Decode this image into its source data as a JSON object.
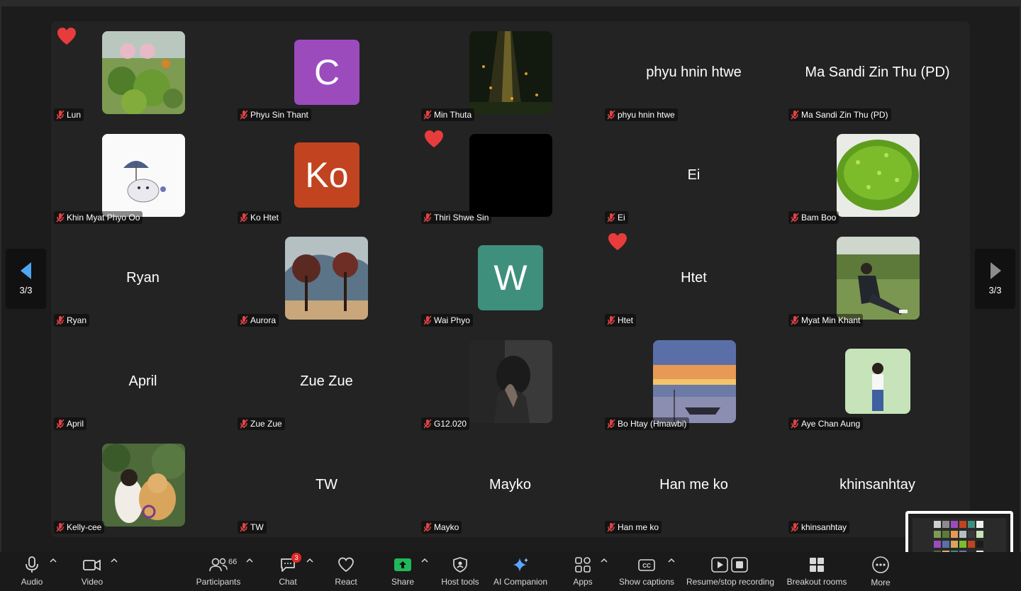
{
  "pager": {
    "left_label": "3/3",
    "right_label": "3/3"
  },
  "participants": [
    {
      "name": "Lun",
      "tile": "photo",
      "photo": "plants"
    },
    {
      "name": "Phyu Sin Thant",
      "tile": "avatar",
      "initials": "C",
      "color": "#9c4bbd"
    },
    {
      "name": "Min Thuta",
      "tile": "photo",
      "photo": "forest-rays"
    },
    {
      "name": "phyu hnin htwe",
      "tile": "name",
      "display": "phyu hnin htwe"
    },
    {
      "name": "Ma Sandi Zin Thu (PD)",
      "tile": "name",
      "display": "Ma Sandi Zin Thu (PD)"
    },
    {
      "name": "Khin Myat Phyo Oo",
      "tile": "photo",
      "photo": "sketch"
    },
    {
      "name": "Ko Htet",
      "tile": "avatar",
      "initials": "Ko",
      "color": "#c2431f"
    },
    {
      "name": "Thiri Shwe Sin",
      "tile": "photo",
      "photo": "black"
    },
    {
      "name": "Ei",
      "tile": "name",
      "display": "Ei"
    },
    {
      "name": "Bam Boo",
      "tile": "photo",
      "photo": "green-beads"
    },
    {
      "name": "Ryan",
      "tile": "name",
      "display": "Ryan"
    },
    {
      "name": "Aurora",
      "tile": "photo",
      "photo": "trees"
    },
    {
      "name": "Wai Phyo",
      "tile": "avatar",
      "initials": "W",
      "color": "#3f8f7d"
    },
    {
      "name": "Htet",
      "tile": "name",
      "display": "Htet"
    },
    {
      "name": "Myat Min Khant",
      "tile": "photo",
      "photo": "field"
    },
    {
      "name": "April",
      "tile": "name",
      "display": "April"
    },
    {
      "name": "Zue Zue",
      "tile": "name",
      "display": "Zue Zue"
    },
    {
      "name": "G12.020",
      "tile": "photo",
      "photo": "portrait-dark"
    },
    {
      "name": "Bo Htay (Hmawbi)",
      "tile": "photo",
      "photo": "sunset"
    },
    {
      "name": "Aye Chan Aung",
      "tile": "photo",
      "photo": "standing-person"
    },
    {
      "name": "Kelly-cee",
      "tile": "photo",
      "photo": "girl-dog"
    },
    {
      "name": "TW",
      "tile": "name",
      "display": "TW"
    },
    {
      "name": "Mayko",
      "tile": "name",
      "display": "Mayko"
    },
    {
      "name": "Han me ko",
      "tile": "name",
      "display": "Han me ko"
    },
    {
      "name": "khinsanhtay",
      "tile": "name",
      "display": "khinsanhtay"
    }
  ],
  "reactions": [
    {
      "participant": "Lun",
      "emoji": "heart"
    },
    {
      "participant": "Thiri Shwe Sin",
      "emoji": "heart"
    },
    {
      "participant": "Htet",
      "emoji": "heart"
    }
  ],
  "toolbar": {
    "audio": "Audio",
    "video": "Video",
    "participants": "Participants",
    "participants_count": "66",
    "chat": "Chat",
    "chat_badge": "3",
    "react": "React",
    "share": "Share",
    "host_tools": "Host tools",
    "ai_companion": "AI Companion",
    "apps": "Apps",
    "show_captions": "Show captions",
    "recording": "Resume/stop recording",
    "breakout": "Breakout rooms",
    "more": "More"
  },
  "colors": {
    "background": "#1c1c1c",
    "gallery": "#232323",
    "toolbar": "#1a1a1a",
    "share_green": "#1fb85a",
    "badge_red": "#e02828",
    "pager_arrow": "#4ea6f2"
  }
}
